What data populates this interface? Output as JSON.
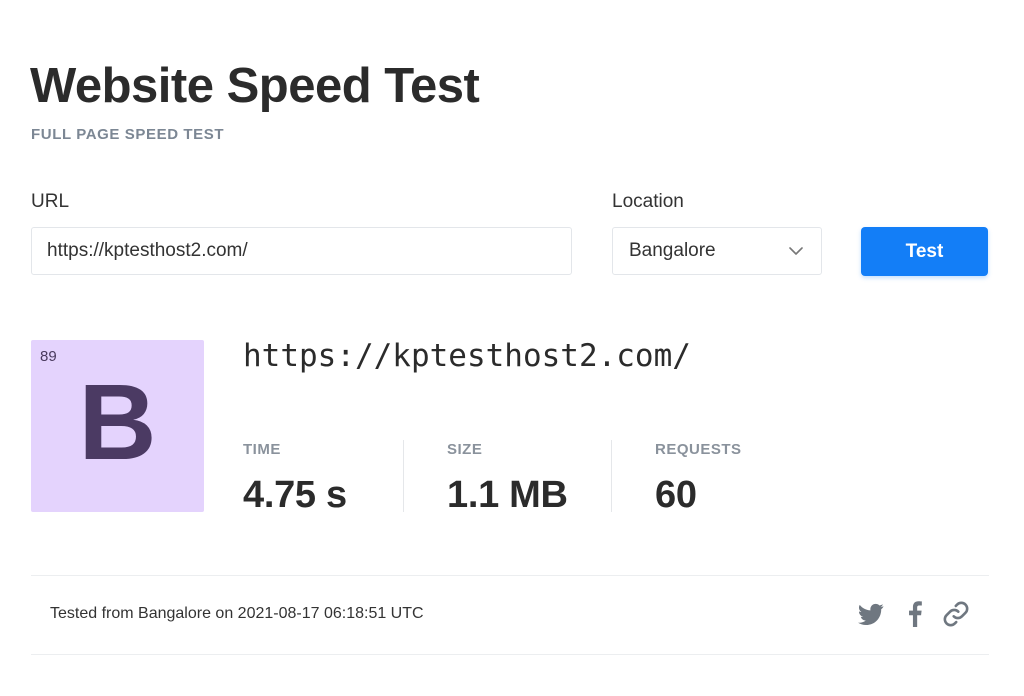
{
  "header": {
    "title": "Website Speed Test",
    "subtitle": "FULL PAGE SPEED TEST"
  },
  "form": {
    "url_label": "URL",
    "url_value": "https://kptesthost2.com/",
    "location_label": "Location",
    "location_value": "Bangalore",
    "test_button_label": "Test"
  },
  "result": {
    "score": "89",
    "grade": "B",
    "grade_color": "#e4d3fd",
    "url": "https://kptesthost2.com/",
    "stats": {
      "time_label": "TIME",
      "time_value": "4.75 s",
      "size_label": "SIZE",
      "size_value": "1.1 MB",
      "requests_label": "REQUESTS",
      "requests_value": "60"
    }
  },
  "footer": {
    "tested_text": "Tested from Bangalore on 2021-08-17 06:18:51 UTC",
    "share_icons": [
      "twitter-icon",
      "facebook-icon",
      "link-icon"
    ]
  },
  "colors": {
    "accent": "#137ef7",
    "grade_text": "#4b3a63"
  }
}
